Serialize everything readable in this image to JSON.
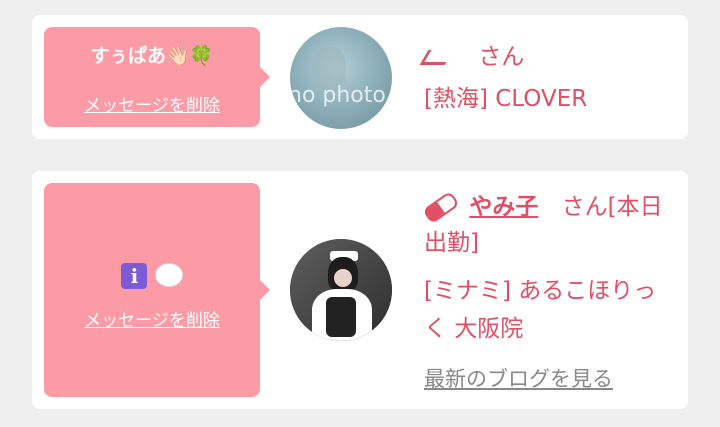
{
  "cards": [
    {
      "message": "すぅぱあ👋🏻🍀",
      "delete_label": "メッセージを削除",
      "avatar_text": "no photo",
      "name": "",
      "san": "さん",
      "shop": "[熱海] CLOVER"
    },
    {
      "delete_label": "メッセージを削除",
      "name": "やみ子",
      "san_line1": "さん[本日",
      "san_line2": "出勤]",
      "shop_line1": "[ミナミ] あるこほりっ",
      "shop_line2": "く 大阪院",
      "blog_link": "最新のブログを見る"
    }
  ],
  "colors": {
    "bubble": "#fc9aa6",
    "accent": "#e04f64",
    "card": "#ffffff",
    "background": "#efefef",
    "muted": "#888888"
  },
  "icons": [
    "info-icon",
    "speech-bubble-icon",
    "pill-icon",
    "waving-hand-icon",
    "clover-icon"
  ]
}
